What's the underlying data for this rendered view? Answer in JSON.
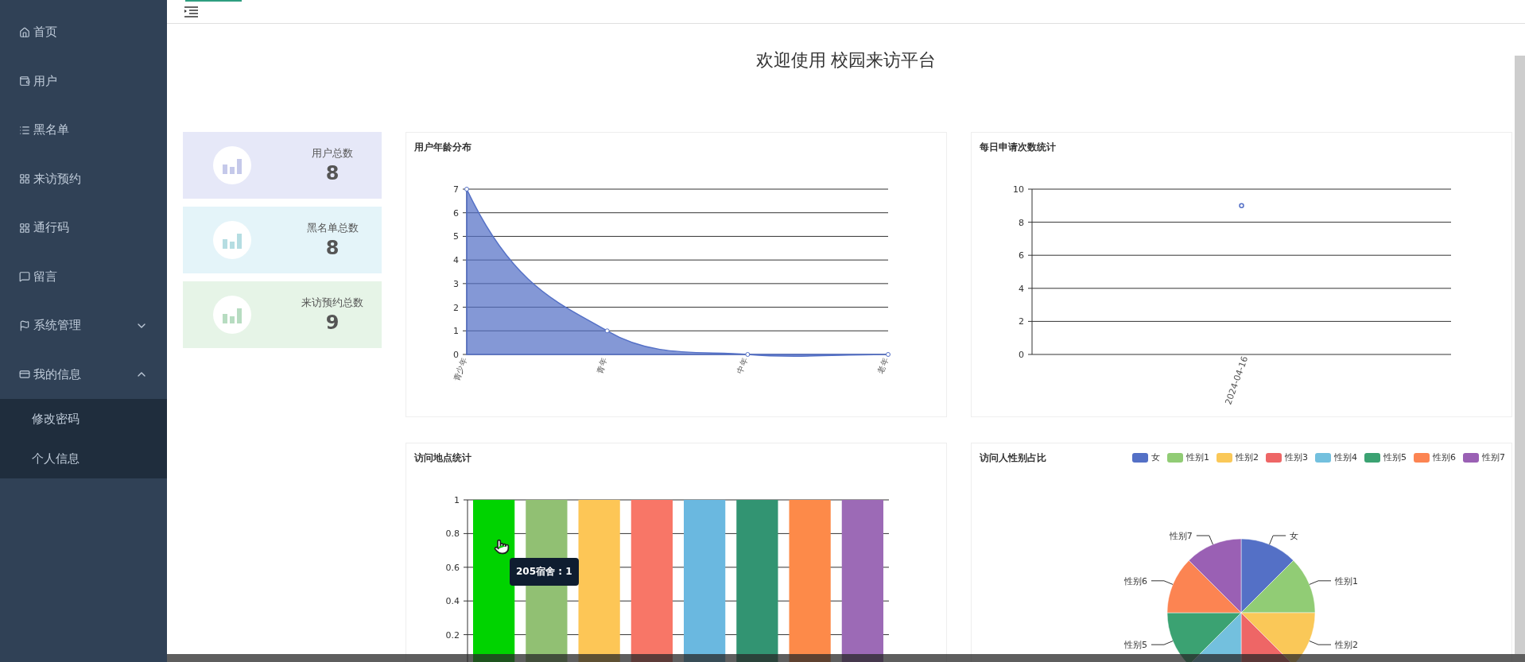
{
  "sidebar": {
    "items": [
      {
        "label": "首页"
      },
      {
        "label": "用户"
      },
      {
        "label": "黑名单"
      },
      {
        "label": "来访预约"
      },
      {
        "label": "通行码"
      },
      {
        "label": "留言"
      },
      {
        "label": "系统管理",
        "expanded": false
      },
      {
        "label": "我的信息",
        "expanded": true,
        "children": [
          {
            "label": "修改密码"
          },
          {
            "label": "个人信息"
          }
        ]
      }
    ]
  },
  "page_title": "欢迎使用 校园来访平台",
  "stats": [
    {
      "label": "用户总数",
      "value": "8",
      "color": "#e6e8f8"
    },
    {
      "label": "黑名单总数",
      "value": "8",
      "color": "#e4f4f9"
    },
    {
      "label": "来访预约总数",
      "value": "9",
      "color": "#e6f4e7"
    }
  ],
  "charts": [
    {
      "title": "用户年龄分布",
      "chart_data": {
        "type": "area",
        "categories": [
          "青少年",
          "青年",
          "中年",
          "老年"
        ],
        "ylim": [
          0,
          7
        ],
        "yticks": [
          0,
          1,
          2,
          3,
          4,
          5,
          6,
          7
        ],
        "grid": true,
        "series": [
          {
            "color": "#5470c6",
            "marker": true,
            "values": [
              7,
              1,
              0,
              0
            ]
          }
        ]
      }
    },
    {
      "title": "每日申请次数统计",
      "chart_data": {
        "type": "line",
        "categories": [
          "2024-04-16"
        ],
        "ylim": [
          0,
          10
        ],
        "yticks": [
          0,
          2,
          4,
          6,
          8,
          10
        ],
        "grid": true,
        "series": [
          {
            "color": "#5470c6",
            "marker": true,
            "values": [
              9
            ]
          }
        ]
      }
    },
    {
      "title": "访问地点统计",
      "tooltip": "205宿舍 : 1",
      "chart_data": {
        "type": "bar",
        "ylim": [
          0,
          1
        ],
        "yticks": [
          0.2,
          0.4,
          0.6,
          0.8,
          1
        ],
        "grid": true,
        "series": [
          {
            "color": "#00d300",
            "values": [
              1
            ]
          },
          {
            "color": "#91c073",
            "values": [
              1
            ]
          },
          {
            "color": "#fdc656",
            "values": [
              1
            ]
          },
          {
            "color": "#f87667",
            "values": [
              1
            ]
          },
          {
            "color": "#6ab8e0",
            "values": [
              1
            ]
          },
          {
            "color": "#329472",
            "values": [
              1
            ]
          },
          {
            "color": "#fd8a49",
            "values": [
              1
            ]
          },
          {
            "color": "#9c6ab6",
            "values": [
              1
            ]
          }
        ]
      }
    },
    {
      "title": "访问人性别占比",
      "chart_data": {
        "type": "pie",
        "categories": [
          "女",
          "性别1",
          "性别2",
          "性别3",
          "性别4",
          "性别5",
          "性别6",
          "性别7"
        ],
        "series": [
          {
            "values": [
              1,
              1,
              1,
              1,
              1,
              1,
              1,
              1
            ]
          }
        ],
        "colors": [
          "#5470c6",
          "#91cc75",
          "#fac858",
          "#ee6666",
          "#73c0de",
          "#3ba272",
          "#fc8452",
          "#9a60b4"
        ]
      }
    }
  ]
}
